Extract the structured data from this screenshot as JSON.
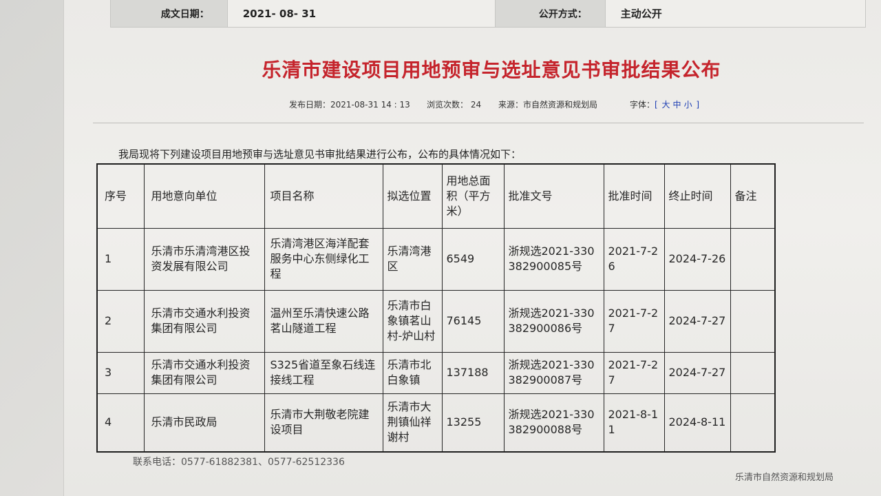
{
  "info_bar": {
    "date_label": "成文日期：",
    "date_value": "2021- 08- 31",
    "disclosure_label": "公开方式：",
    "disclosure_value": "主动公开"
  },
  "article": {
    "title": "乐清市建设项目用地预审与选址意见书审批结果公布",
    "publish_label": "发布日期：",
    "publish_value": "2021-08-31 14 : 13",
    "views_label": "浏览次数：",
    "views_value": "24",
    "source_label": "来源：",
    "source_value": "市自然资源和规划局",
    "font_label": "字体：",
    "font_bracket_open": "[",
    "font_sizes": [
      "大",
      "中",
      "小"
    ],
    "font_bracket_close": "]",
    "intro": "我局现将下列建设项目用地预审与选址意见书审批结果进行公布，公布的具体情况如下：",
    "contact": "联系电话：0577-61882381、0577-62512336",
    "signature": "乐清市自然资源和规划局"
  },
  "table": {
    "headers": [
      "序号",
      "用地意向单位",
      "项目名称",
      "拟选位置",
      "用地总面积（平方米）",
      "批准文号",
      "批准时间",
      "终止时间",
      "备注"
    ],
    "rows": [
      [
        "1",
        "乐清市乐清湾港区投资发展有限公司",
        "乐清湾港区海洋配套服务中心东侧绿化工程",
        "乐清湾港区",
        "6549",
        "浙规选2021-330382900085号",
        "2021-7-26",
        "2024-7-26",
        ""
      ],
      [
        "2",
        "乐清市交通水利投资集团有限公司",
        "温州至乐清快速公路茗山隧道工程",
        "乐清市白象镇茗山村-炉山村",
        "76145",
        "浙规选2021-330382900086号",
        "2021-7-27",
        "2024-7-27",
        ""
      ],
      [
        "3",
        "乐清市交通水利投资集团有限公司",
        "S325省道至象石线连接线工程",
        "乐清市北白象镇",
        "137188",
        "浙规选2021-330382900087号",
        "2021-7-27",
        "2024-7-27",
        ""
      ],
      [
        "4",
        "乐清市民政局",
        "乐清市大荆敬老院建设项目",
        "乐清市大荆镇仙祥谢村",
        "13255",
        "浙规选2021-330382900088号",
        "2021-8-11",
        "2024-8-11",
        ""
      ]
    ]
  },
  "colors": {
    "title": "#c5242c",
    "link": "#1c3db3",
    "text": "#222222",
    "label_bg": "#d8d8d5",
    "value_bg": "#efeeeb"
  }
}
